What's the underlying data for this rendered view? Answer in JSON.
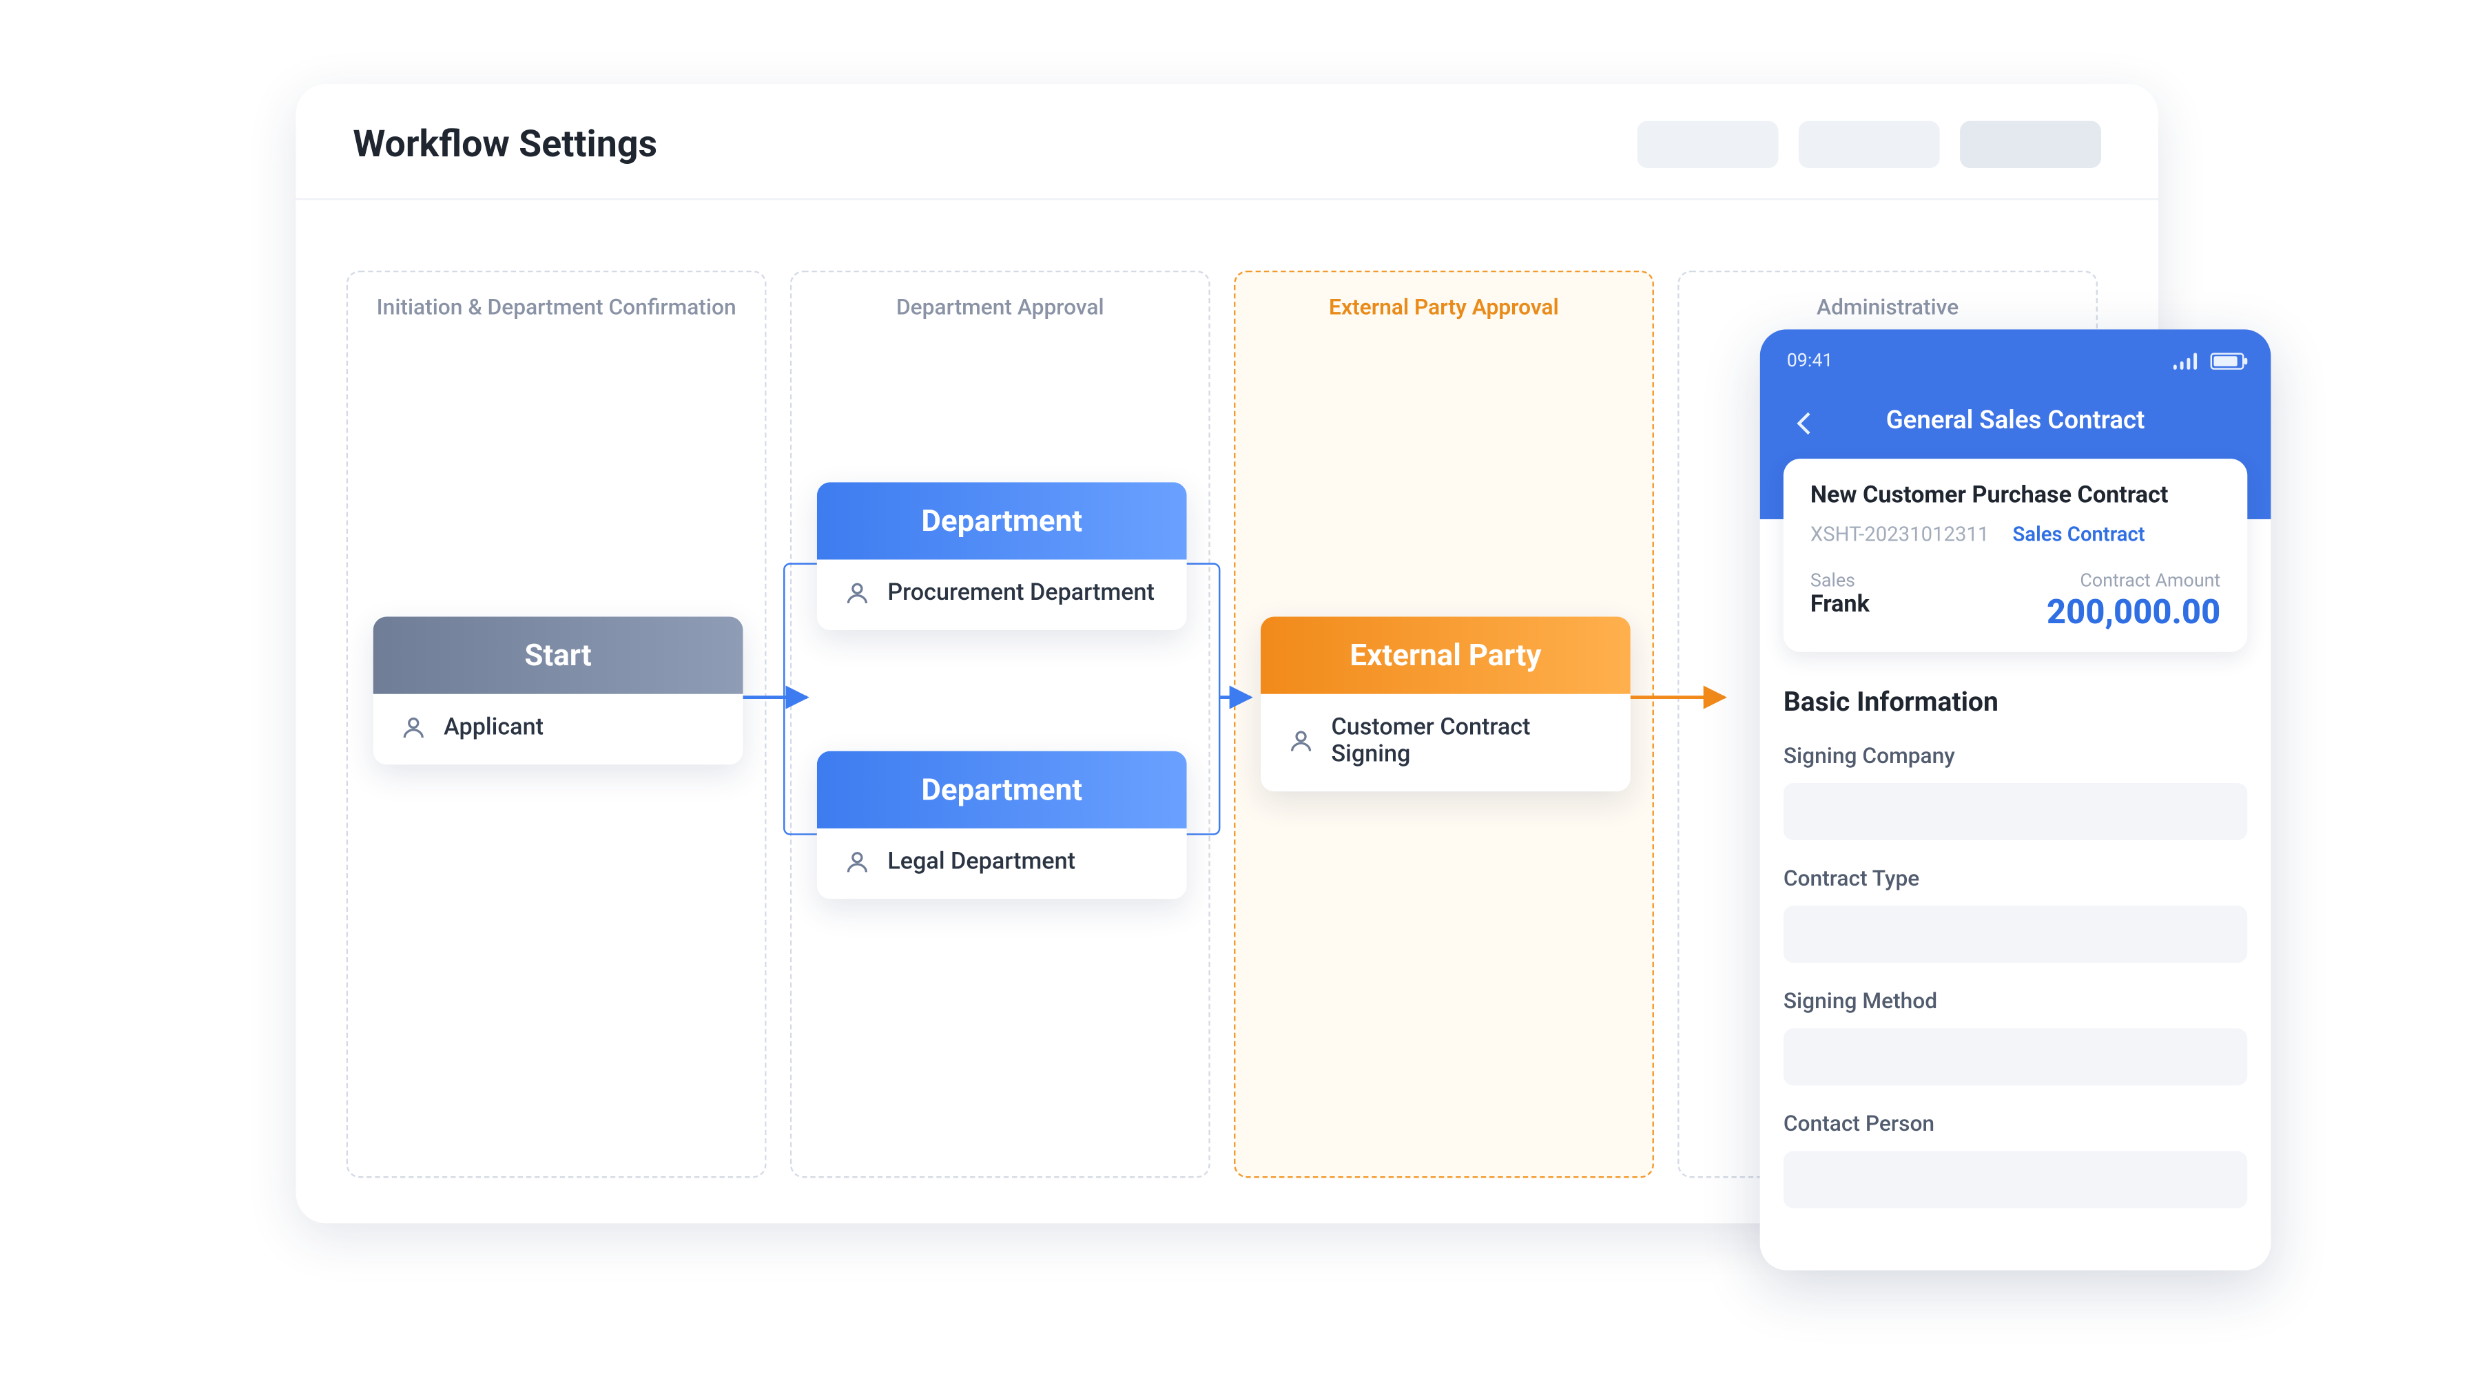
{
  "header": {
    "title": "Workflow Settings"
  },
  "lanes": [
    {
      "title": "Initiation & Department Confirmation"
    },
    {
      "title": "Department Approval"
    },
    {
      "title": "External Party Approval"
    },
    {
      "title": "Administrative"
    }
  ],
  "nodes": {
    "start": {
      "title": "Start",
      "role": "Applicant"
    },
    "deptA": {
      "title": "Department",
      "role": "Procurement Department"
    },
    "deptB": {
      "title": "Department",
      "role": "Legal Department"
    },
    "ext": {
      "title": "External Party",
      "role": "Customer Contract Signing"
    }
  },
  "phone": {
    "status_time": "09:41",
    "header_title": "General Sales Contract",
    "summary": {
      "title": "New Customer Purchase Contract",
      "code": "XSHT-20231012311",
      "tag": "Sales Contract",
      "sales_label": "Sales",
      "sales_value": "Frank",
      "amount_label": "Contract Amount",
      "amount_value": "200,000.00"
    },
    "section_title": "Basic Information",
    "fields": [
      "Signing Company",
      "Contract Type",
      "Signing Method",
      "Contact Person"
    ]
  },
  "colors": {
    "accent_blue": "#3d7cf0",
    "accent_orange": "#f18a1a",
    "lane_border": "#d5dbe6"
  }
}
